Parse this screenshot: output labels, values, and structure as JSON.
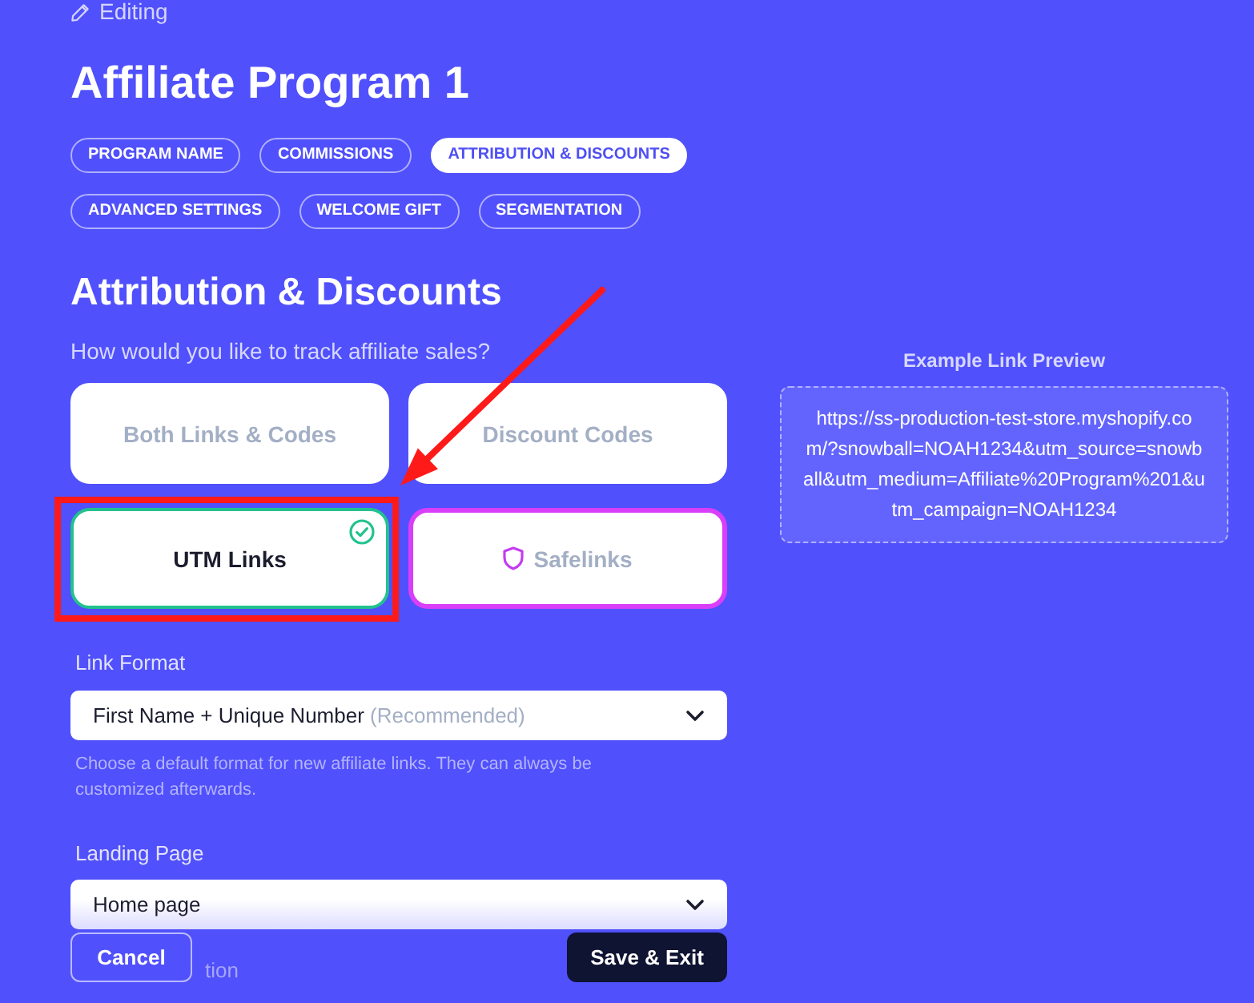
{
  "header": {
    "status": "Editing",
    "title": "Affiliate Program 1"
  },
  "tabs": [
    {
      "label": "PROGRAM NAME",
      "selected": false
    },
    {
      "label": "COMMISSIONS",
      "selected": false
    },
    {
      "label": "ATTRIBUTION & DISCOUNTS",
      "selected": true
    },
    {
      "label": "ADVANCED SETTINGS",
      "selected": false
    },
    {
      "label": "WELCOME GIFT",
      "selected": false
    },
    {
      "label": "SEGMENTATION",
      "selected": false
    }
  ],
  "section": {
    "title": "Attribution & Discounts",
    "question": "How would you like to track affiliate sales?"
  },
  "tracking_options": [
    {
      "label": "Both Links & Codes",
      "kind": "standard",
      "selected": false,
      "annotated": false
    },
    {
      "label": "Discount Codes",
      "kind": "standard",
      "selected": false,
      "annotated": false
    },
    {
      "label": "UTM Links",
      "kind": "standard",
      "selected": true,
      "annotated": true
    },
    {
      "label": "Safelinks",
      "kind": "featured",
      "selected": false,
      "annotated": false
    }
  ],
  "link_format": {
    "label": "Link Format",
    "value": "First Name + Unique Number",
    "note": "(Recommended)",
    "hint": "Choose a default format for new affiliate links. They can always be customized afterwards."
  },
  "landing_page": {
    "label": "Landing Page",
    "value": "Home page"
  },
  "next_field": {
    "label": "tion"
  },
  "preview": {
    "title": "Example Link Preview",
    "url": "https://ss-production-test-store.myshopify.com/?snowball=NOAH1234&utm_source=snowball&utm_medium=Affiliate%20Program%201&utm_campaign=NOAH1234"
  },
  "footer": {
    "buttons": [
      {
        "label": "Cancel",
        "kind": "secondary"
      },
      {
        "label": "Save & Exit",
        "kind": "primary"
      }
    ]
  }
}
